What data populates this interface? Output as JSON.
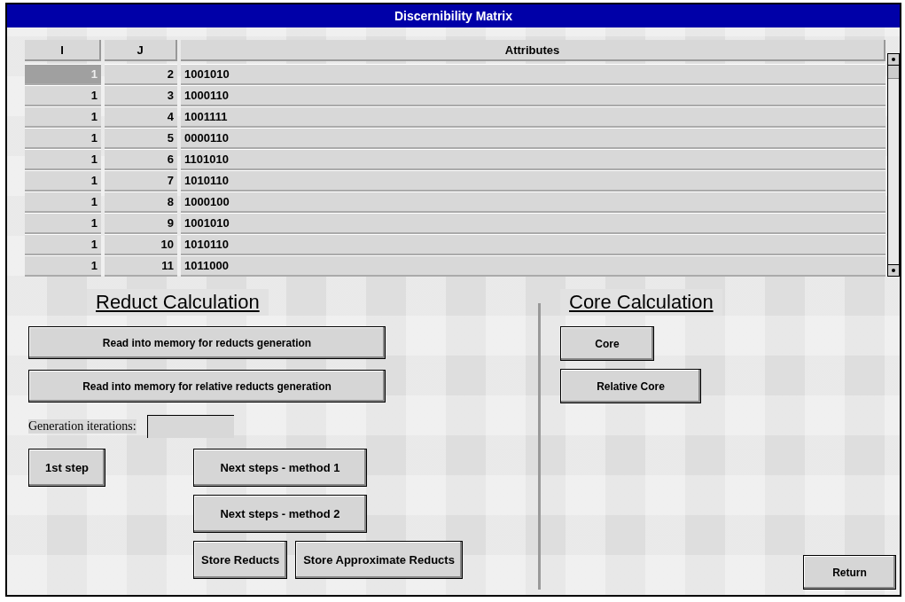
{
  "window": {
    "title": "Discernibility Matrix"
  },
  "table": {
    "columns": [
      "I",
      "J",
      "Attributes"
    ],
    "rows": [
      {
        "i": "1",
        "j": "2",
        "attributes": "1001010",
        "selected": true
      },
      {
        "i": "1",
        "j": "3",
        "attributes": "1000110",
        "selected": false
      },
      {
        "i": "1",
        "j": "4",
        "attributes": "1001111",
        "selected": false
      },
      {
        "i": "1",
        "j": "5",
        "attributes": "0000110",
        "selected": false
      },
      {
        "i": "1",
        "j": "6",
        "attributes": "1101010",
        "selected": false
      },
      {
        "i": "1",
        "j": "7",
        "attributes": "1010110",
        "selected": false
      },
      {
        "i": "1",
        "j": "8",
        "attributes": "1000100",
        "selected": false
      },
      {
        "i": "1",
        "j": "9",
        "attributes": "1001010",
        "selected": false
      },
      {
        "i": "1",
        "j": "10",
        "attributes": "1010110",
        "selected": false
      },
      {
        "i": "1",
        "j": "11",
        "attributes": "1011000",
        "selected": false
      }
    ]
  },
  "reduct_calculation": {
    "heading": "Reduct Calculation",
    "read_reducts_button": "Read into memory for reducts generation",
    "read_relative_reducts_button": "Read into memory for relative reducts generation",
    "iterations_label": "Generation iterations:",
    "first_step_button": "1st step",
    "next_method1_button": "Next steps - method 1",
    "next_method2_button": "Next steps - method 2",
    "store_reducts_button": "Store Reducts",
    "store_approximate_button": "Store Approximate Reducts"
  },
  "core_calculation": {
    "heading": "Core Calculation",
    "core_button": "Core",
    "relative_core_button": "Relative Core"
  },
  "return_button": "Return"
}
